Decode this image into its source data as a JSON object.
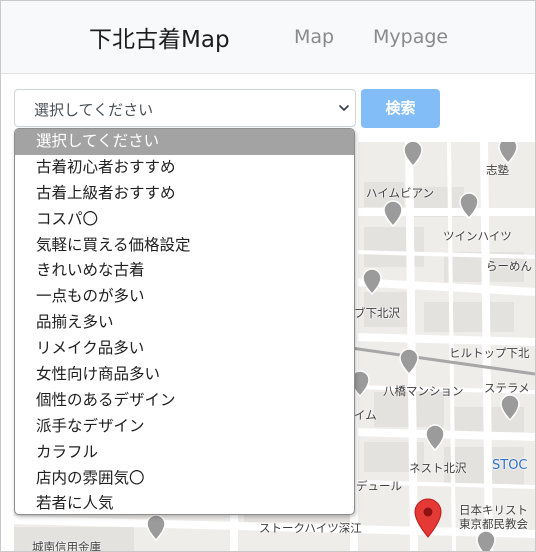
{
  "navbar": {
    "brand": "下北古着Map",
    "links": [
      "Map",
      "Mypage"
    ]
  },
  "search": {
    "selected_value": "選択してください",
    "button_label": "検索"
  },
  "dropdown": {
    "options": [
      "選択してください",
      "古着初心者おすすめ",
      "古着上級者おすすめ",
      "コスパ〇",
      "気軽に買える価格設定",
      "きれいめな古着",
      "一点ものが多い",
      "品揃え多い",
      "リメイク品多い",
      "女性向け商品多い",
      "個性のあるデザイン",
      "派手なデザイン",
      "カラフル",
      "店内の雰囲気〇",
      "若者に人気"
    ],
    "selected_index": 0
  },
  "map": {
    "labels": [
      "志塾",
      "ハイムビアン",
      "ツインハイツ",
      "らーめん",
      "ブ下北沢",
      "ヒルトップ下北",
      "八橋マンション",
      "ステラメ",
      "イム",
      "ネスト北沢",
      "STOC",
      "デュール",
      "日本キリスト",
      "東京都民教会",
      "ストークハイツ深江",
      "城南信用金庫"
    ]
  },
  "colors": {
    "search_button": "#82bdf7",
    "selected_option": "#a3a3a3",
    "map_pin_red": "#e53935",
    "map_pin_gray": "#9e9e9e"
  }
}
